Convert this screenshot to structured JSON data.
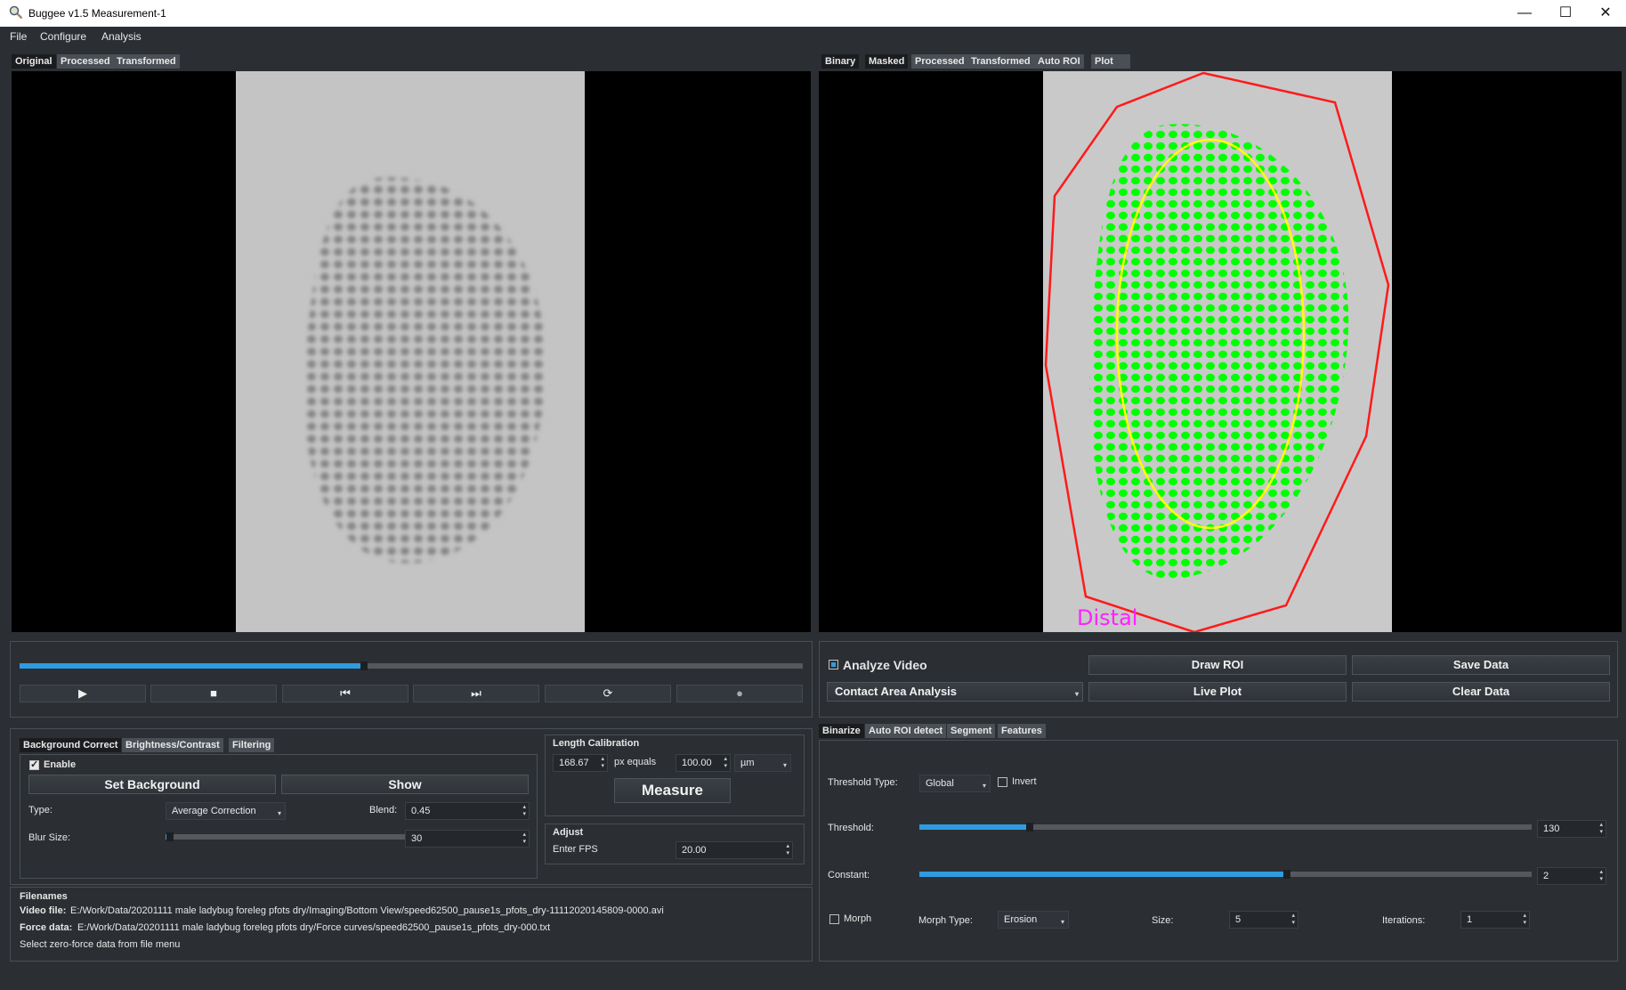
{
  "window": {
    "title": "Buggee v1.5 Measurement-1",
    "minimize": "—",
    "maximize": "☐",
    "close": "✕"
  },
  "menu": [
    "File",
    "Configure",
    "Analysis"
  ],
  "left_tabs": [
    "Original",
    "Processed",
    "Transformed"
  ],
  "right_tabs": [
    "Binary",
    "Masked",
    "Processed",
    "Transformed",
    "Auto ROI",
    "Plot"
  ],
  "overlay_label": "Distal",
  "playback": {
    "progress": 0.44,
    "buttons": [
      "play-icon",
      "stop-icon",
      "skip-back-icon",
      "skip-forward-icon",
      "loop-icon",
      "record-icon"
    ],
    "glyphs": [
      "▶",
      "■",
      "⏮",
      "⏭",
      "⟳",
      "●"
    ]
  },
  "analysis": {
    "analyze_video": "Analyze Video",
    "mode": "Contact Area Analysis",
    "draw_roi": "Draw ROI",
    "live_plot": "Live Plot",
    "save_data": "Save Data",
    "clear_data": "Clear Data"
  },
  "bg_tabs": [
    "Background Correct",
    "Brightness/Contrast",
    "Filtering"
  ],
  "background": {
    "enable": "Enable",
    "set_background": "Set Background",
    "show": "Show",
    "type_label": "Type:",
    "type_value": "Average Correction",
    "blend_label": "Blend:",
    "blend_value": "0.45",
    "blur_label": "Blur Size:",
    "blur_value": "30",
    "blur_level": 0.02
  },
  "calibration": {
    "title": "Length Calibration",
    "px_value": "168.67",
    "px_equals": "px equals",
    "length_value": "100.00",
    "unit": "µm",
    "measure": "Measure"
  },
  "adjust": {
    "title": "Adjust",
    "fps_label": "Enter FPS",
    "fps_value": "20.00"
  },
  "filenames": {
    "title": "Filenames",
    "video_label": "Video file:",
    "video_path": "E:/Work/Data/20201111 male ladybug foreleg pfots dry/Imaging/Bottom View/speed62500_pause1s_pfots_dry-11112020145809-0000.avi",
    "force_label": "Force data:",
    "force_path": "E:/Work/Data/20201111 male ladybug foreleg pfots dry/Force curves/speed62500_pause1s_pfots_dry-000.txt",
    "hint": "Select zero-force data from file menu"
  },
  "bin_tabs": [
    "Binarize",
    "Auto ROI detect",
    "Segment",
    "Features"
  ],
  "binarize": {
    "threshold_type_label": "Threshold Type:",
    "threshold_type_value": "Global",
    "invert": "Invert",
    "threshold_label": "Threshold:",
    "threshold_value": "130",
    "threshold_level": 0.18,
    "constant_label": "Constant:",
    "constant_value": "2",
    "constant_level": 0.6,
    "morph": "Morph",
    "morph_type_label": "Morph Type:",
    "morph_type_value": "Erosion",
    "size_label": "Size:",
    "size_value": "5",
    "iterations_label": "Iterations:",
    "iterations_value": "1"
  },
  "colors": {
    "accent": "#2f9be0",
    "roi": "#ff1a1a",
    "ellipse": "#ffff00",
    "contacts": "#00ff00",
    "label": "#ff22ff"
  }
}
